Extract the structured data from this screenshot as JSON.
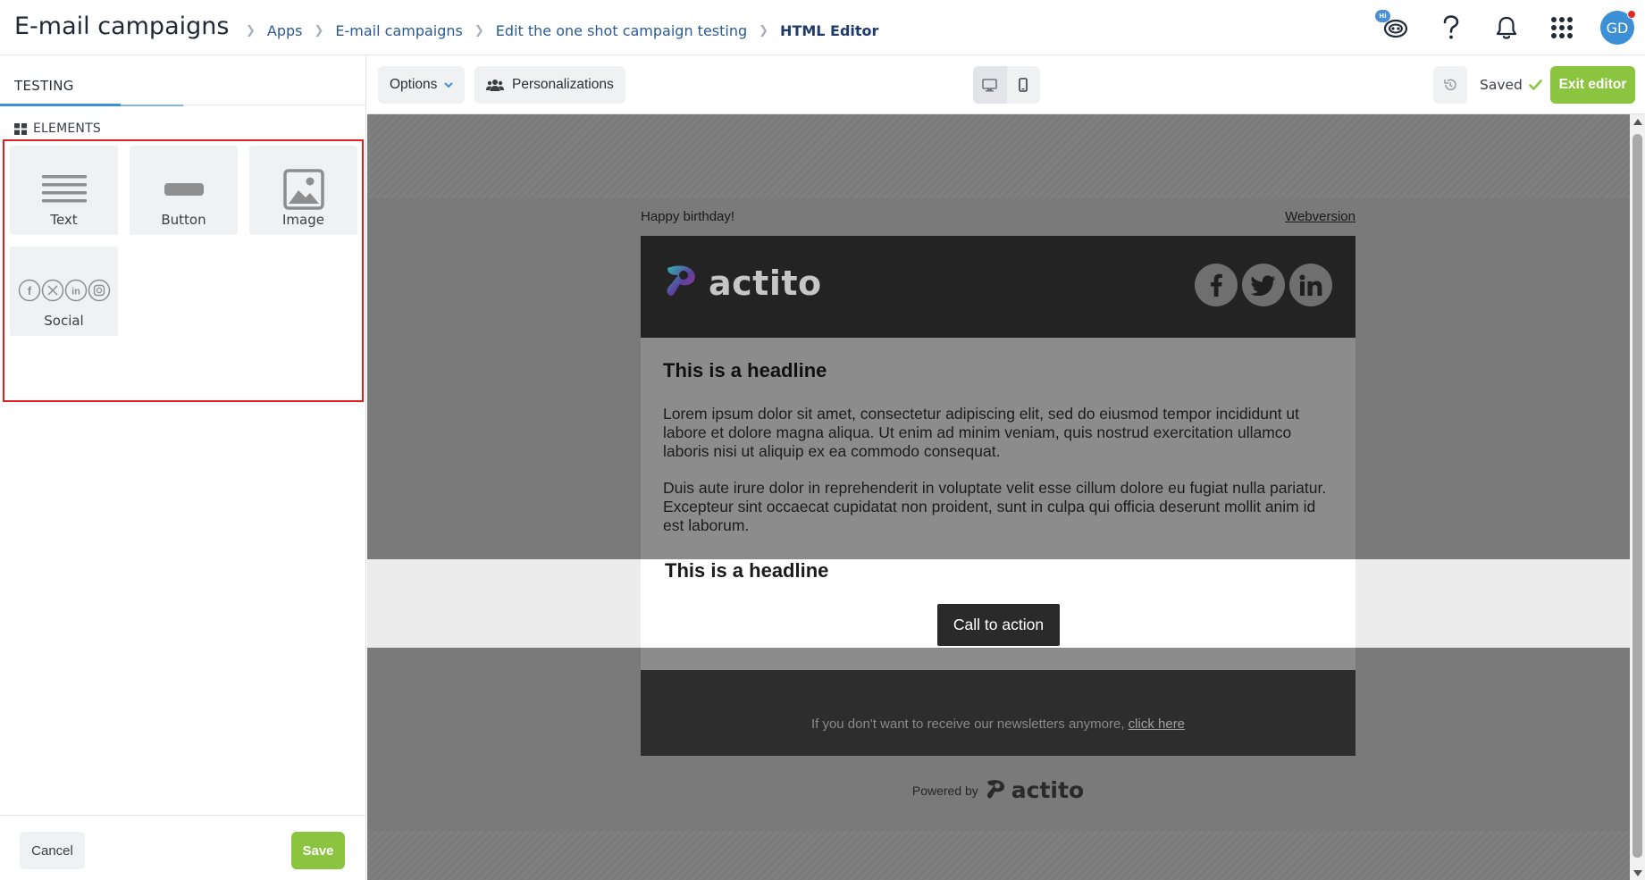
{
  "header": {
    "title": "E-mail campaigns",
    "breadcrumb": [
      "Apps",
      "E-mail campaigns",
      "Edit the one shot campaign testing",
      "HTML Editor"
    ],
    "icons": [
      "assistant-icon",
      "help-icon",
      "bell-icon",
      "apps-grid-icon"
    ],
    "assistant_badge": "Hi",
    "avatar_initials": "GD"
  },
  "left_panel": {
    "tab": "TESTING",
    "section_title": "ELEMENTS",
    "elements": [
      {
        "label": "Text",
        "icon": "text-lines-icon"
      },
      {
        "label": "Button",
        "icon": "button-bar-icon"
      },
      {
        "label": "Image",
        "icon": "image-icon"
      },
      {
        "label": "Social",
        "icon": "social-icons"
      }
    ],
    "cancel_label": "Cancel",
    "save_label": "Save"
  },
  "toolbar": {
    "options_label": "Options",
    "personalizations_label": "Personalizations",
    "devices": [
      "desktop-icon",
      "mobile-icon"
    ],
    "saved_label": "Saved",
    "exit_label": "Exit editor"
  },
  "email": {
    "preheader": "Happy birthday!",
    "webversion": "Webversion",
    "logo_text": "actito",
    "headline": "This is a headline",
    "paragraph1": "Lorem ipsum dolor sit amet, consectetur adipiscing elit, sed do eiusmod tempor incididunt ut labore et dolore magna aliqua. Ut enim ad minim veniam, quis nostrud exercitation ullamco laboris nisi ut aliquip ex ea commodo consequat.",
    "paragraph2": "Duis aute irure dolor in reprehenderit in voluptate velit esse cillum dolore eu fugiat nulla pariatur. Excepteur sint occaecat cupidatat non proident, sunt in culpa qui officia deserunt mollit anim id est laborum.",
    "headline2": "This is a headline",
    "cta_label": "Call to action",
    "footer_text": "If you don't want to receive our newsletters anymore, ",
    "footer_link": "click here",
    "powered_by": "Powered by",
    "powered_logo_text": "actito"
  },
  "colors": {
    "accent_green": "#8bc43f",
    "accent_blue": "#3d8fd6",
    "selection_red": "#e02020"
  }
}
